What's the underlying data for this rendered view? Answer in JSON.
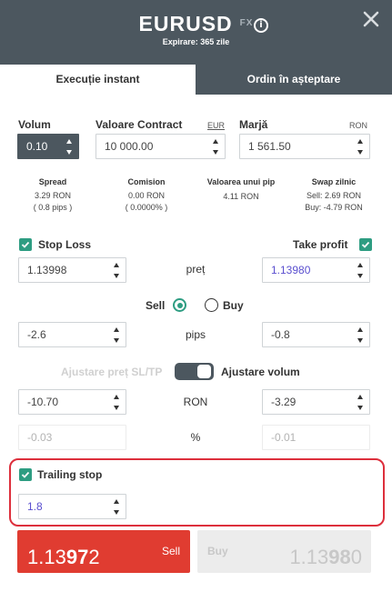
{
  "header": {
    "symbol": "EURUSD",
    "symbol_tag": "FX",
    "expiry": "Expirare: 365 zile",
    "info_icon": "info-icon",
    "close_icon": "close-icon",
    "background": "#4c575f"
  },
  "tabs": [
    {
      "label": "Execuție instant",
      "active": true
    },
    {
      "label": "Ordin în așteptare",
      "active": false
    }
  ],
  "fields": {
    "volume": {
      "label": "Volum",
      "value": "0.10"
    },
    "contract": {
      "label": "Valoare Contract",
      "unit": "EUR",
      "value": "10 000.00"
    },
    "margin": {
      "label": "Marjă",
      "unit": "RON",
      "value": "1 561.50"
    }
  },
  "stats": [
    {
      "title": "Spread",
      "line1": "3.29 RON",
      "line2": "( 0.8 pips )"
    },
    {
      "title": "Comision",
      "line1": "0.00 RON",
      "line2": "( 0.0000% )"
    },
    {
      "title": "Valoarea unui pip",
      "line1": "4.11 RON",
      "line2": ""
    },
    {
      "title": "Swap zilnic",
      "line1": "Sell: 2.69 RON",
      "line2": "Buy: -4.79 RON"
    }
  ],
  "stop_loss": {
    "label": "Stop Loss",
    "checked": true,
    "price": "1.13998",
    "pips": "-2.6",
    "amount": "-10.70",
    "percent": "-0.03"
  },
  "take_profit": {
    "label": "Take profit",
    "checked": true,
    "price": "1.13980",
    "pips": "-0.8",
    "amount": "-3.29",
    "percent": "-0.01"
  },
  "middle_labels": {
    "price": "preț",
    "pips": "pips",
    "currency": "RON",
    "percent": "%"
  },
  "direction": {
    "sell_label": "Sell",
    "buy_label": "Buy",
    "selected": "Sell"
  },
  "adjust": {
    "left_label": "Ajustare preț SL/TP",
    "right_label": "Ajustare volum",
    "toggle_on": true
  },
  "trailing_stop": {
    "label": "Trailing stop",
    "checked": true,
    "value": "1.8"
  },
  "buttons": {
    "sell": {
      "label": "Sell",
      "price_start": "1.13",
      "price_big": "97",
      "price_end": "2"
    },
    "buy": {
      "label": "Buy",
      "price_start": "1.13",
      "price_big": "98",
      "price_end": "0"
    }
  },
  "colors": {
    "accent": "#2e9d82",
    "sell": "#e03c31",
    "highlight": "#dd2f3c",
    "tp_value": "#5a4fcf"
  }
}
